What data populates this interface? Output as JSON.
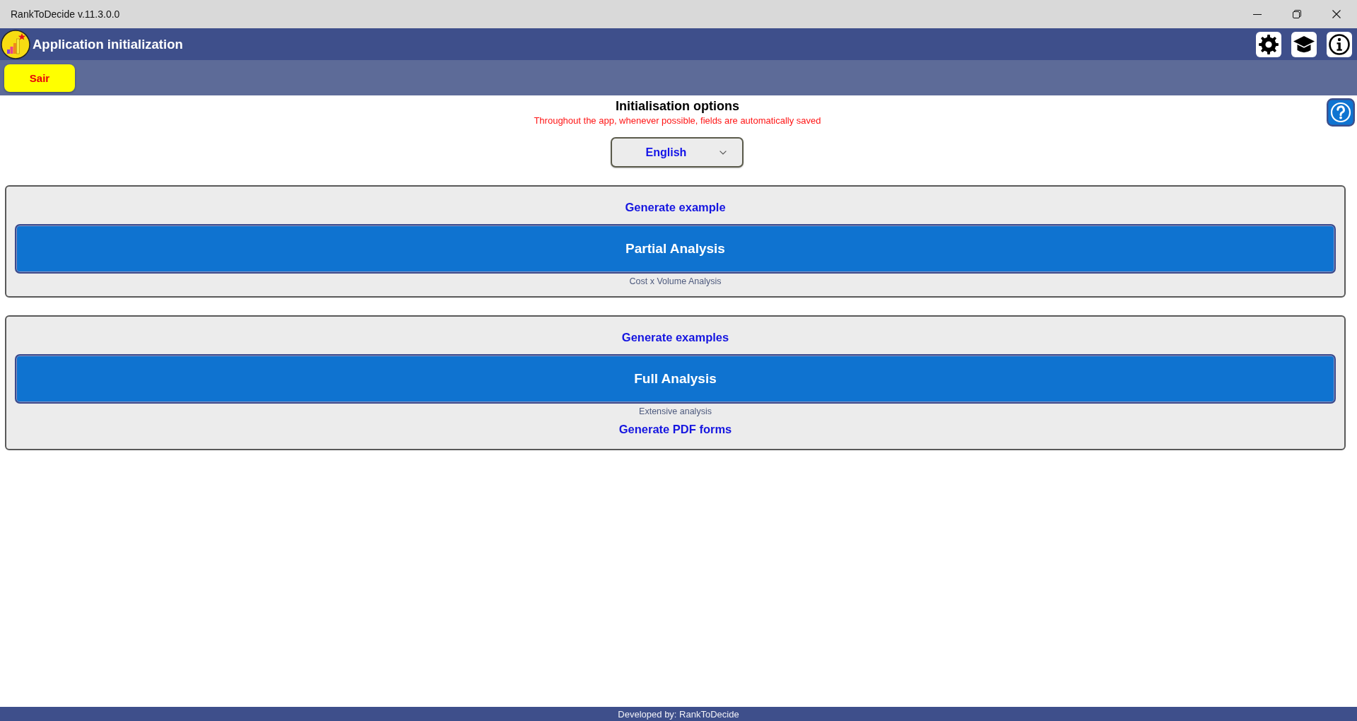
{
  "window": {
    "title": "RankToDecide v.11.3.0.0"
  },
  "header": {
    "title": "Application initialization"
  },
  "toolbar": {
    "exit_button": "Sair"
  },
  "page": {
    "title": "Initialisation options",
    "notice": "Throughout the app, whenever possible, fields are automatically saved",
    "language": {
      "value": "English"
    }
  },
  "sections": [
    {
      "heading": "Generate example",
      "button": "Partial Analysis",
      "caption": "Cost x Volume Analysis"
    },
    {
      "heading": "Generate examples",
      "button": "Full Analysis",
      "caption": "Extensive analysis",
      "link": "Generate PDF forms"
    }
  ],
  "status_bar": {
    "text": "Developed by: RankToDecide"
  }
}
